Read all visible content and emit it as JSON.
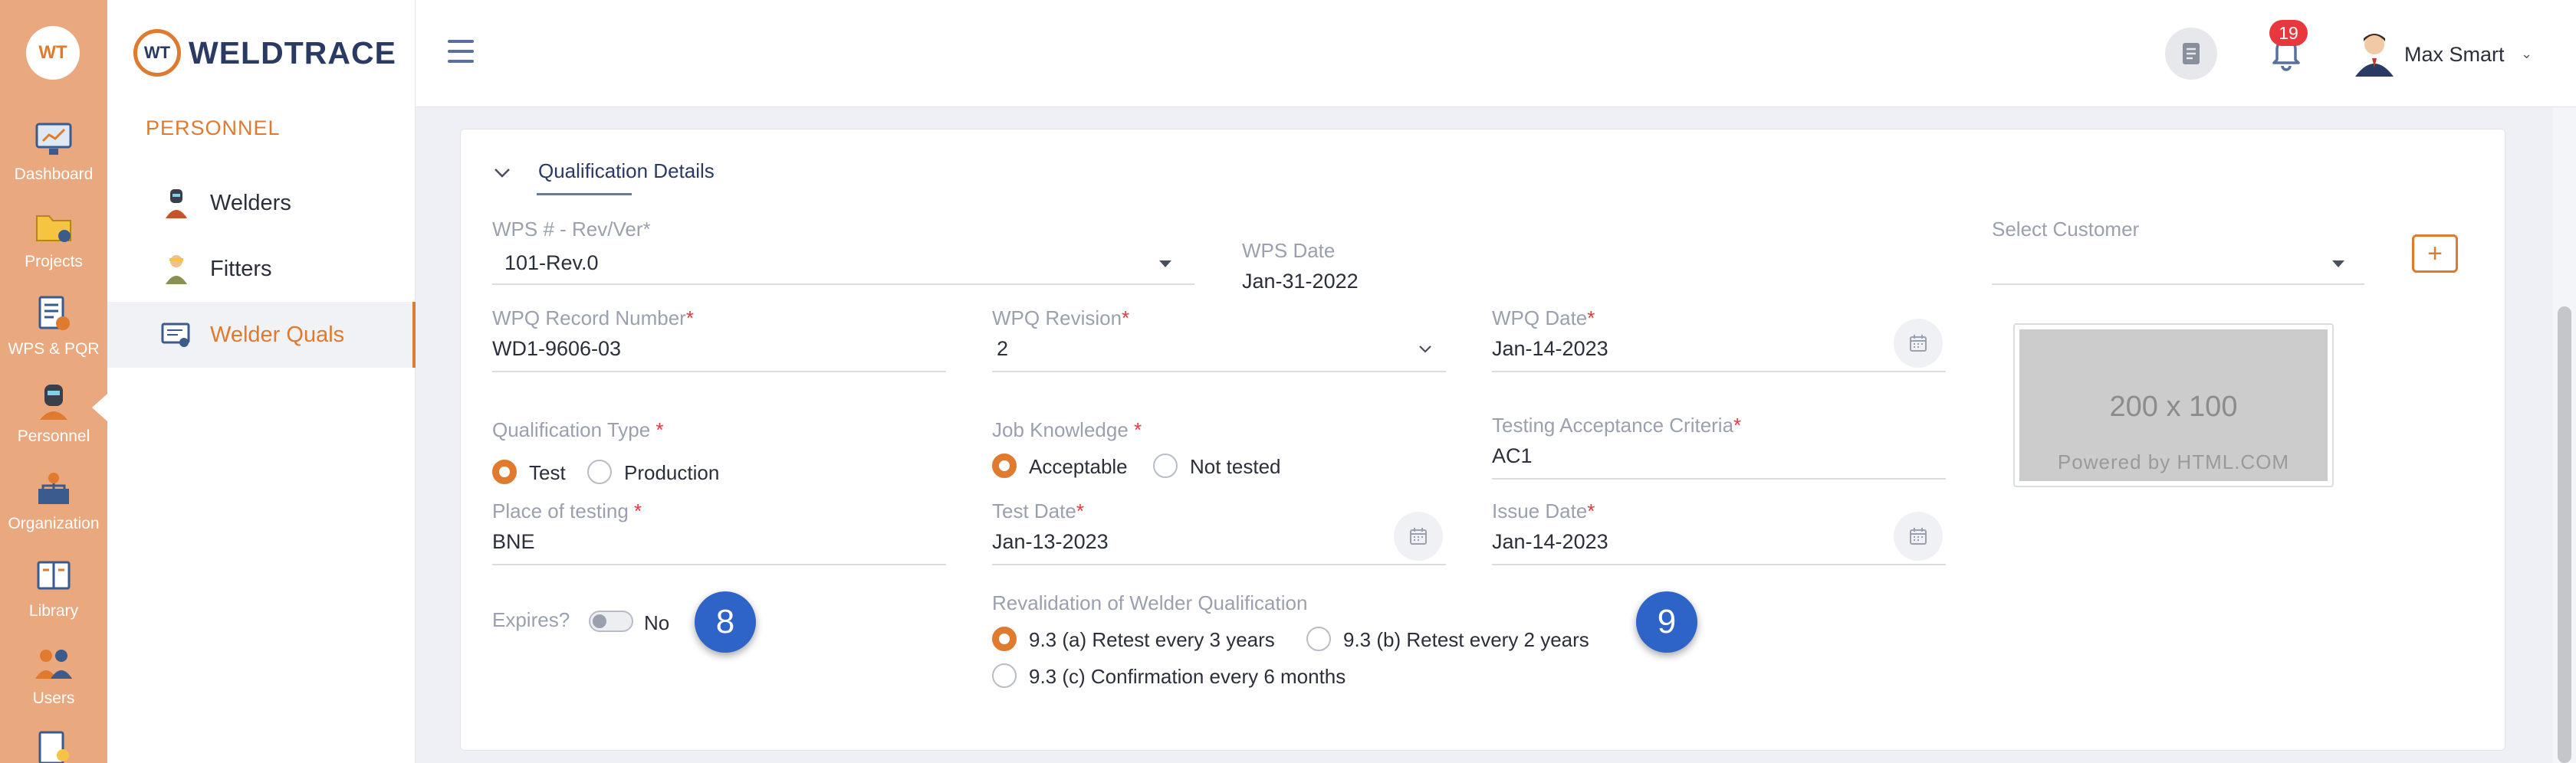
{
  "rail": {
    "logo_text": "WT",
    "items": [
      {
        "label": "Dashboard",
        "icon": "dashboard-icon"
      },
      {
        "label": "Projects",
        "icon": "projects-folder-icon"
      },
      {
        "label": "WPS & PQR",
        "icon": "wps-pqr-icon"
      },
      {
        "label": "Personnel",
        "icon": "welder-mask-icon"
      },
      {
        "label": "Organization",
        "icon": "organization-icon"
      },
      {
        "label": "Library",
        "icon": "library-book-icon"
      },
      {
        "label": "Users",
        "icon": "users-icon"
      }
    ]
  },
  "subnav": {
    "brand_mark": "WT",
    "brand_text": "WELDTRACE",
    "section": "PERSONNEL",
    "items": [
      {
        "label": "Welders",
        "icon": "welder-person-icon"
      },
      {
        "label": "Fitters",
        "icon": "fitter-person-icon"
      },
      {
        "label": "Welder Quals",
        "icon": "certificate-icon"
      }
    ]
  },
  "topbar": {
    "notification_count": "19",
    "user_name": "Max Smart"
  },
  "form": {
    "section_title": "Qualification Details",
    "wps": {
      "label": "WPS # - Rev/Ver*",
      "value": "101-Rev.0"
    },
    "wps_date": {
      "label": "WPS Date",
      "value": "Jan-31-2022"
    },
    "customer": {
      "label": "Select Customer",
      "value": ""
    },
    "wpq_record": {
      "label": "WPQ Record Number",
      "req": "*",
      "value": "WD1-9606-03"
    },
    "wpq_revision": {
      "label": "WPQ Revision",
      "req": "*",
      "value": "2"
    },
    "wpq_date": {
      "label": "WPQ Date",
      "req": "*",
      "value": "Jan-14-2023"
    },
    "qual_type": {
      "label": "Qualification Type ",
      "req": "*",
      "options": [
        "Test",
        "Production"
      ],
      "selected": "Test"
    },
    "job_knowledge": {
      "label": "Job Knowledge ",
      "req": "*",
      "options": [
        "Acceptable",
        "Not tested"
      ],
      "selected": "Acceptable"
    },
    "acceptance": {
      "label": "Testing Acceptance Criteria",
      "req": "*",
      "value": "AC1"
    },
    "place": {
      "label": "Place of testing ",
      "req": "*",
      "value": "BNE"
    },
    "test_date": {
      "label": "Test Date",
      "req": "*",
      "value": "Jan-13-2023"
    },
    "issue_date": {
      "label": "Issue Date",
      "req": "*",
      "value": "Jan-14-2023"
    },
    "expires": {
      "label": "Expires?",
      "value": "No",
      "on": false
    },
    "revalidation": {
      "label": "Revalidation of Welder Qualification",
      "options": [
        "9.3 (a) Retest every 3 years",
        "9.3 (b) Retest every 2 years",
        "9.3 (c) Confirmation every 6 months"
      ],
      "selected": "9.3 (a) Retest every 3 years"
    },
    "placeholder_image": {
      "size_text": "200 x 100",
      "powered_text": "Powered by HTML.COM"
    }
  },
  "step_markers": [
    "8",
    "9"
  ],
  "colors": {
    "accent": "#e07a2e",
    "rail_bg": "#e9a87e",
    "badge": "#e8383d",
    "step_marker": "#2e64c8",
    "brand_navy": "#2a3a63"
  }
}
